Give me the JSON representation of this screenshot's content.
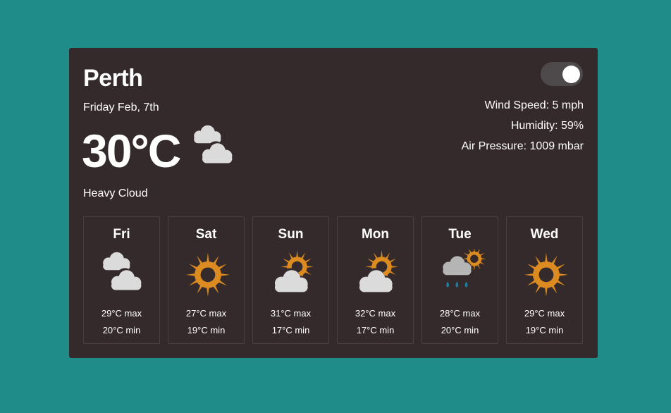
{
  "location": {
    "city": "Perth",
    "date": "Friday Feb, 7th"
  },
  "current": {
    "temperature": "30°C",
    "condition": "Heavy Cloud",
    "icon": "heavy-cloud-icon"
  },
  "toggle": {
    "state": "on"
  },
  "stats": {
    "wind": "Wind Speed: 5 mph",
    "humidity": "Humidity: 59%",
    "pressure": "Air Pressure: 1009 mbar"
  },
  "forecast": [
    {
      "day": "Fri",
      "icon": "heavy-cloud-icon",
      "max": "29°C max",
      "min": "20°C min"
    },
    {
      "day": "Sat",
      "icon": "sun-icon",
      "max": "27°C max",
      "min": "19°C min"
    },
    {
      "day": "Sun",
      "icon": "partly-cloudy-icon",
      "max": "31°C max",
      "min": "17°C min"
    },
    {
      "day": "Mon",
      "icon": "partly-cloudy-icon",
      "max": "32°C max",
      "min": "17°C min"
    },
    {
      "day": "Tue",
      "icon": "rain-showers-icon",
      "max": "28°C max",
      "min": "20°C min"
    },
    {
      "day": "Wed",
      "icon": "sun-icon",
      "max": "29°C max",
      "min": "19°C min"
    }
  ],
  "colors": {
    "background": "#1f8c8a",
    "card": "#352a2b",
    "sun": "#dc8b20",
    "cloud": "#dcdbdc",
    "rain": "#1f7ea0"
  }
}
